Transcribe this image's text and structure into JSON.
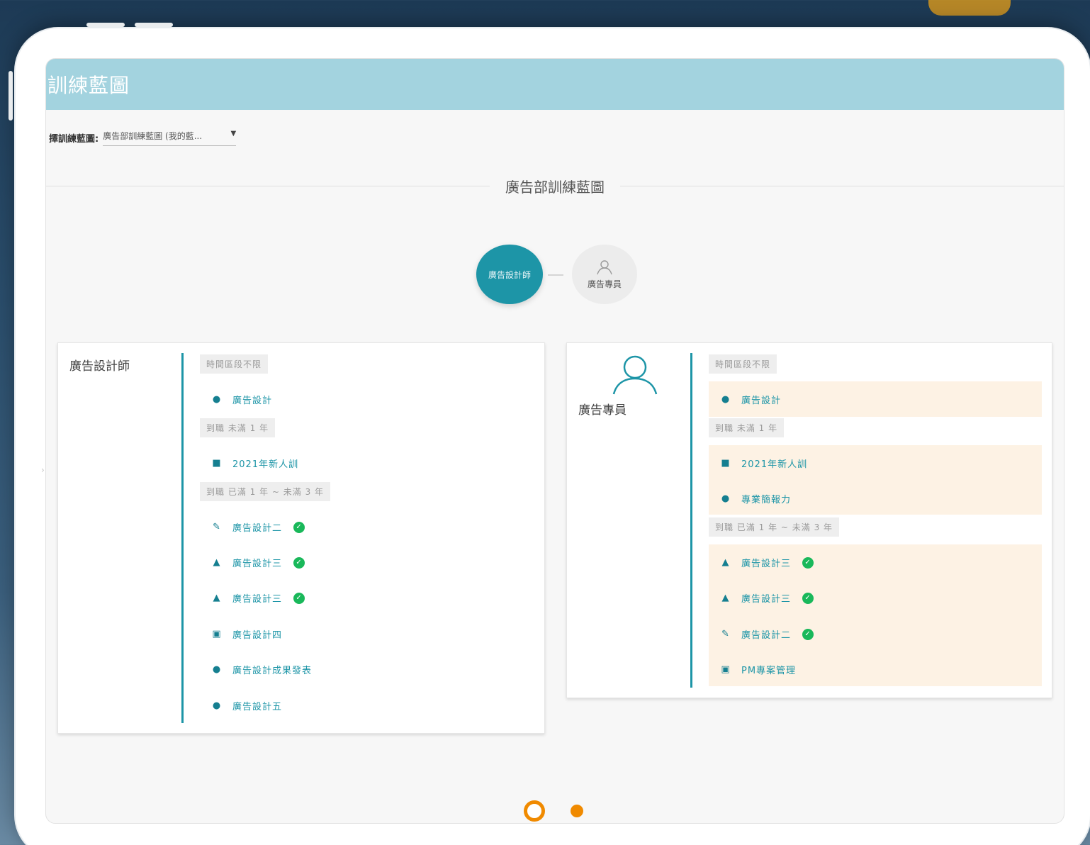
{
  "app": {
    "title": "訓練藍圖"
  },
  "selector": {
    "label": "擇訓練藍圖:",
    "value": "廣告部訓練藍圖 (我的藍..."
  },
  "section_title": "廣告部訓練藍圖",
  "nodes": {
    "active": "廣告設計師",
    "inactive": "廣告專員"
  },
  "left_card": {
    "title": "廣告設計師",
    "tag1": "時間區段不限",
    "item1": "廣告設計",
    "tag2": "到職 未滿 1 年",
    "item2": "2021年新人訓",
    "tag3": "到職 已滿 1 年 ~ 未滿 3 年",
    "item3": "廣告設計二",
    "item4": "廣告設計三",
    "item5": "廣告設計三",
    "item6": "廣告設計四",
    "item7": "廣告設計成果發表",
    "item8": "廣告設計五"
  },
  "right_card": {
    "title": "廣告專員",
    "tag1": "時間區段不限",
    "item1": "廣告設計",
    "tag2": "到職 未滿 1 年",
    "item2": "2021年新人訓",
    "item3": "專業簡報力",
    "tag3": "到職 已滿 1 年 ~ 未滿 3 年",
    "item4": "廣告設計三",
    "item5": "廣告設計三",
    "item6": "廣告設計二",
    "item7": "PM專案管理"
  },
  "colors": {
    "accent": "#1d95a7",
    "header": "#a3d3df",
    "highlight": "#fdf2e4",
    "pager": "#f08a00",
    "check": "#19b85a"
  },
  "icons": [
    "globe-icon",
    "folder-icon",
    "pencil-icon",
    "graduation-cap-icon",
    "bag-icon",
    "check-icon",
    "user-icon"
  ]
}
